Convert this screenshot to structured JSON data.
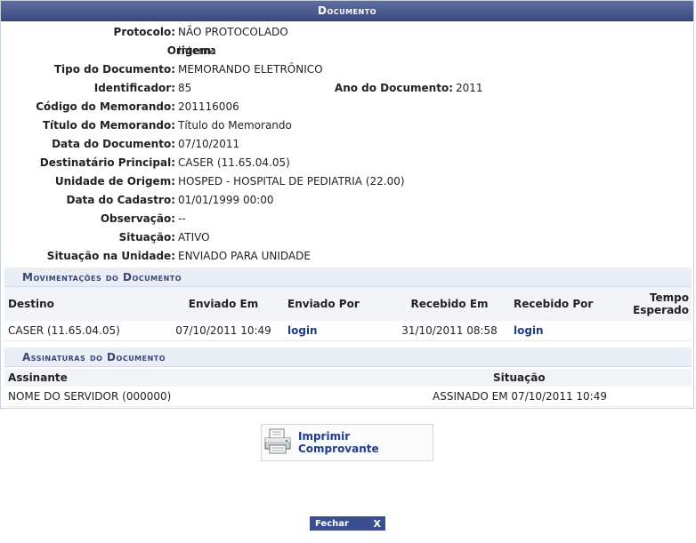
{
  "header": {
    "title": "Documento"
  },
  "info": {
    "protocolo": {
      "label": "Protocolo:",
      "value": "NÃO PROTOCOLADO"
    },
    "origem": {
      "label": "Origem:",
      "value": "Interna"
    },
    "tipo": {
      "label": "Tipo do Documento:",
      "value": "MEMORANDO ELETRÔNICO"
    },
    "identificador": {
      "label": "Identificador:",
      "value": "85"
    },
    "ano": {
      "label": "Ano do Documento:",
      "value": "2011"
    },
    "codigo": {
      "label": "Código do Memorando:",
      "value": "201116006"
    },
    "titulo": {
      "label": "Título do Memorando:",
      "value": "Título do Memorando"
    },
    "data_doc": {
      "label": "Data do Documento:",
      "value": "07/10/2011"
    },
    "destinatario": {
      "label": "Destinatário Principal:",
      "value": "CASER (11.65.04.05)"
    },
    "unidade": {
      "label": "Unidade de Origem:",
      "value": "HOSPED - HOSPITAL DE PEDIATRIA (22.00)"
    },
    "data_cadastro": {
      "label": "Data do Cadastro:",
      "value": "01/01/1999 00:00"
    },
    "observacao": {
      "label": "Observação:",
      "value": "--"
    },
    "situacao": {
      "label": "Situação:",
      "value": "ATIVO"
    },
    "situacao_unidade": {
      "label": "Situação na Unidade:",
      "value": "ENVIADO PARA UNIDADE"
    }
  },
  "movimentacoes": {
    "title": "Movimentações do Documento",
    "headers": {
      "destino": "Destino",
      "enviado_em": "Enviado Em",
      "enviado_por": "Enviado Por",
      "recebido_em": "Recebido Em",
      "recebido_por": "Recebido Por",
      "tempo_1": "Tempo",
      "tempo_2": "Esperado"
    },
    "rows": [
      {
        "destino": "CASER (11.65.04.05)",
        "enviado_em": "07/10/2011 10:49",
        "enviado_por": "login",
        "recebido_em": "31/10/2011 08:58",
        "recebido_por": "login",
        "tempo": ""
      }
    ]
  },
  "assinaturas": {
    "title": "Assinaturas do Documento",
    "headers": {
      "assinante": "Assinante",
      "situacao": "Situação"
    },
    "rows": [
      {
        "assinante": "NOME DO SERVIDOR (000000)",
        "situacao": "ASSINADO EM 07/10/2011 10:49"
      }
    ]
  },
  "actions": {
    "print_label": "Imprimir Comprovante",
    "close_label": "Fechar",
    "close_x": "X"
  },
  "colors": {
    "header": "#3b4a7f",
    "section_bar": "#e9edf5",
    "link": "#1f3c8a",
    "signed": "#3a9a2a",
    "close_button": "#3b4f8f"
  },
  "icons": {
    "print": "printer-icon",
    "close": "close-icon"
  }
}
